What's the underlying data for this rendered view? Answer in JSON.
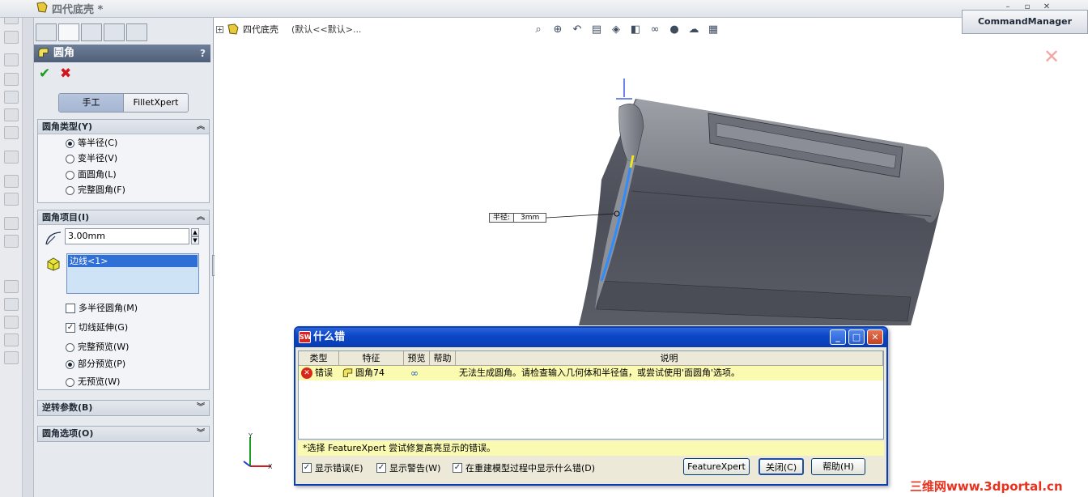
{
  "window": {
    "document_title": "四代底壳 *"
  },
  "property_manager": {
    "title": "圆角",
    "help_label": "?",
    "ok_icon": "check-icon",
    "cancel_icon": "x-icon",
    "mode_tabs": [
      "手工",
      "FilletXpert"
    ],
    "fillet_type_group": {
      "title": "圆角类型(Y)",
      "options": [
        "等半径(C)",
        "变半径(V)",
        "面圆角(L)",
        "完整圆角(F)"
      ],
      "selected": 0
    },
    "fillet_items_group": {
      "title": "圆角项目(I)",
      "radius_value": "3.00mm",
      "selection_list": [
        "边线<1>"
      ],
      "multi_radius_label": "多半径圆角(M)",
      "multi_radius_checked": false,
      "tangent_propagation_label": "切线延伸(G)",
      "tangent_propagation_checked": true,
      "preview_options": [
        "完整预览(W)",
        "部分预览(P)",
        "无预览(W)"
      ],
      "preview_selected": 1
    },
    "reverse_group_title": "逆转参数(B)",
    "options_group_title": "圆角选项(O)"
  },
  "viewport": {
    "tree_crumb": {
      "part_name": "四代底壳",
      "config": "(默认<<默认>..."
    },
    "command_manager_label": "CommandManager",
    "callout": {
      "label": "半径:",
      "value": "3mm"
    },
    "triad_labels": [
      "Y",
      "X"
    ]
  },
  "error_dialog": {
    "title": "什么错",
    "columns": [
      "类型",
      "特征",
      "预览",
      "帮助",
      "说明"
    ],
    "rows": [
      {
        "type": "错误",
        "feature": "圆角74",
        "description": "无法生成圆角。请检查输入几何体和半径值，或尝试使用'面圆角'选项。"
      }
    ],
    "hint": "*选择 FeatureXpert 尝试修复高亮显示的错误。",
    "show_errors_label": "显示错误(E)",
    "show_errors_checked": true,
    "show_warnings_label": "显示警告(W)",
    "show_warnings_checked": true,
    "show_on_rebuild_label": "在重建模型过程中显示什么错(D)",
    "show_on_rebuild_checked": true,
    "buttons": [
      "FeatureXpert",
      "关闭(C)",
      "帮助(H)"
    ]
  },
  "watermark": "三维网www.3dportal.cn"
}
